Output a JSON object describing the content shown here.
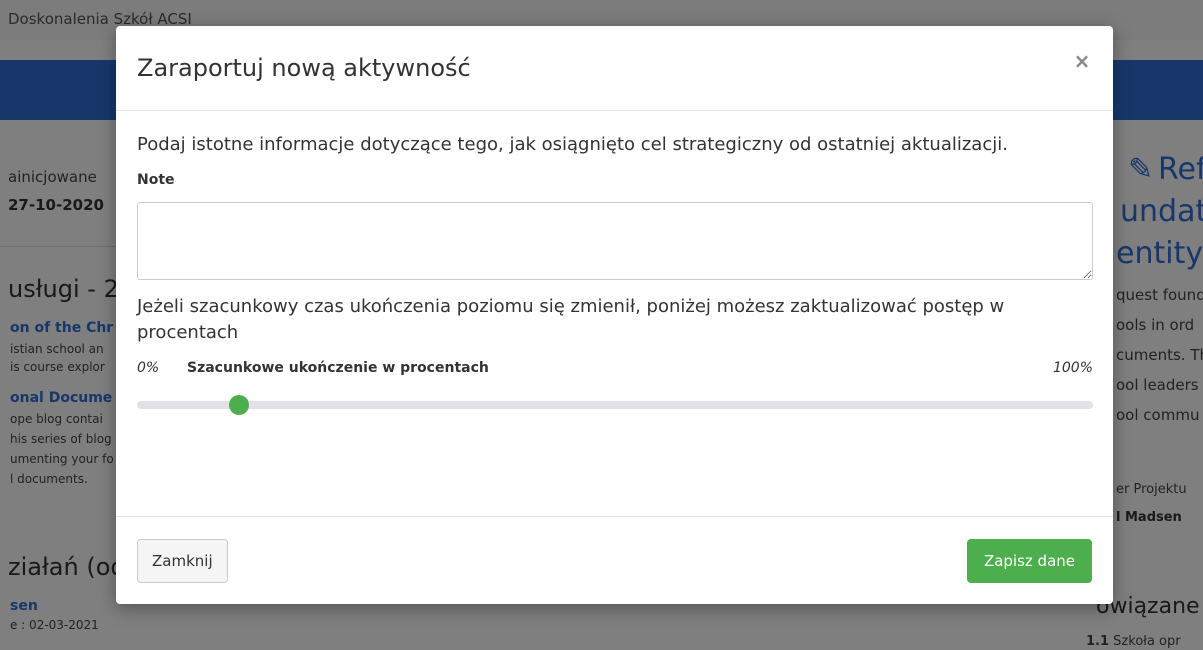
{
  "background": {
    "top_title": "Doskonalenia Szkół ACSI",
    "left": {
      "initiated": "ainicjowane",
      "date": "27-10-2020",
      "section1": "usługi - 2",
      "link1": "on of the Chr",
      "text1a": "istian school an",
      "text1b": "is course explor",
      "link2": "onal Docume",
      "text2a": "ope blog contai",
      "text2b": "his series of blog",
      "text2c": "umenting your fo",
      "text2d": "l documents.",
      "section2": "ziałań (od",
      "person": "sen",
      "person_date": "e : 02-03-2021"
    },
    "right": {
      "title1": "Refin",
      "title2": "undat",
      "title3": "entity",
      "desc1": "quest found",
      "desc2": "ools in ord",
      "desc3": "cuments. Th",
      "desc4": "ool leaders",
      "desc5": "ool commu",
      "manager_label": "er Projektu",
      "manager_name": "l Madsen",
      "related": "owiązane",
      "related_item_num": "1.1",
      "related_item": "Szkoła opr"
    }
  },
  "modal": {
    "title": "Zaraportuj nową aktywność",
    "close_symbol": "×",
    "intro": "Podaj istotne informacje dotyczące tego, jak osiągnięto cel strategiczny od ostatniej aktualizacji.",
    "note_label": "Note",
    "note_value": "",
    "progress_text": "Jeżeli szacunkowy czas ukończenia poziomu się zmienił, poniżej możesz zaktualizować postęp w procentach",
    "slider": {
      "min_label": "0%",
      "title": "Szacunkowe ukończenie w procentach",
      "max_label": "100%",
      "value_fraction": 0.107
    },
    "close_button": "Zamknij",
    "save_button": "Zapisz dane"
  },
  "colors": {
    "primary_blue": "#2e6fd6",
    "success_green": "#4cae4c",
    "overlay": "rgba(0,0,0,0.5)"
  }
}
